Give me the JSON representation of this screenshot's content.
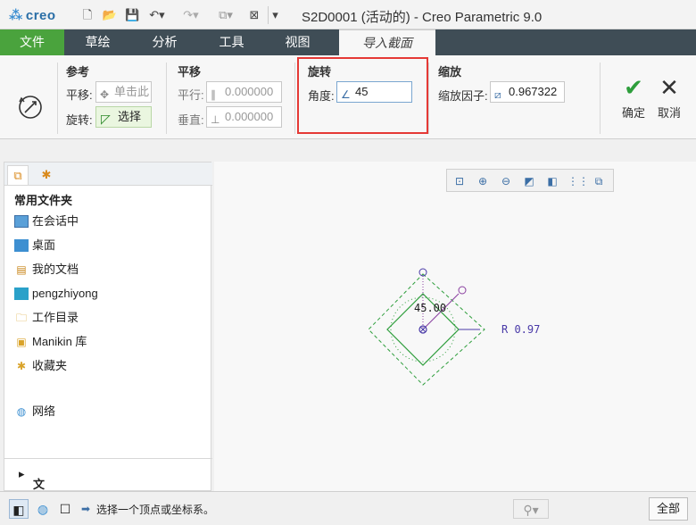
{
  "app": {
    "logo": "creo",
    "window_title": "S2D0001 (活动的) - Creo Parametric 9.0"
  },
  "tabs": {
    "file": "文件",
    "sketch": "草绘",
    "analysis": "分析",
    "tools": "工具",
    "view": "视图",
    "import_section": "导入截面"
  },
  "ribbon": {
    "reference": {
      "title": "参考",
      "translate_label": "平移:",
      "translate_placeholder": "单击此",
      "rotate_label": "旋转:",
      "rotate_select": "选择"
    },
    "translate": {
      "title": "平移",
      "parallel_label": "平行:",
      "parallel_value": "0.000000",
      "perpendicular_label": "垂直:",
      "perpendicular_value": "0.000000"
    },
    "rotate": {
      "title": "旋转",
      "angle_label": "角度:",
      "angle_value": "45"
    },
    "scale": {
      "title": "缩放",
      "factor_label": "缩放因子:",
      "factor_value": "0.967322"
    },
    "ok_label": "确定",
    "cancel_label": "取消"
  },
  "folders": {
    "header": "常用文件夹",
    "items": [
      {
        "label": "在会话中",
        "icon": "monitor-icon"
      },
      {
        "label": "桌面",
        "icon": "desktop-icon"
      },
      {
        "label": "我的文档",
        "icon": "documents-icon"
      },
      {
        "label": "pengzhiyong",
        "icon": "user-computer-icon"
      },
      {
        "label": "工作目录",
        "icon": "working-folder-icon"
      },
      {
        "label": "Manikin 库",
        "icon": "manikin-library-icon"
      },
      {
        "label": "收藏夹",
        "icon": "favorites-icon"
      }
    ],
    "network": "网络",
    "tree": "文件夹树"
  },
  "canvas": {
    "angle_dim": "45.00",
    "scale_dim": "R 0.97"
  },
  "status": {
    "message": "选择一个顶点或坐标系。",
    "filter": "全部"
  },
  "colors": {
    "file_tab": "#4aa33d",
    "tab_bar": "#3f4d56",
    "sketch_green": "#2e9e3c",
    "highlight": "#e53935",
    "dimension": "#4a3aa8"
  }
}
